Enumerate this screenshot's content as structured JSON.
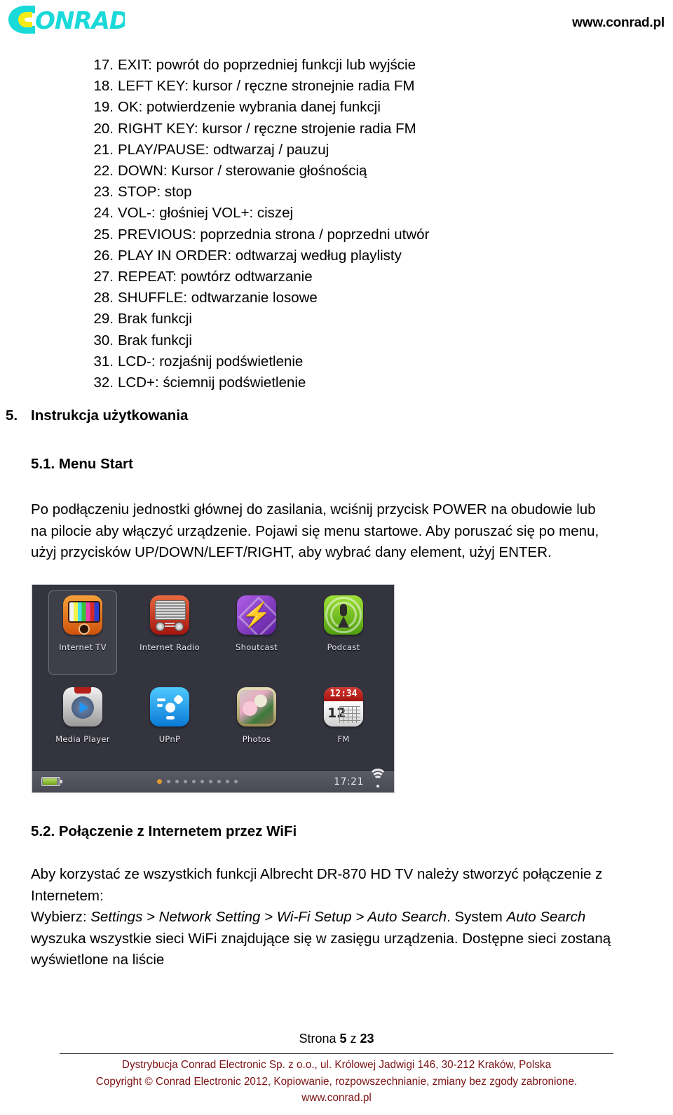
{
  "header": {
    "logo_text": "CONRAD",
    "url": "www.conrad.pl"
  },
  "remote_functions": [
    {
      "num": "17.",
      "text": "EXIT: powrót do poprzedniej funkcji lub wyjście"
    },
    {
      "num": "18.",
      "text": "LEFT KEY: kursor / ręczne stronejnie radia FM"
    },
    {
      "num": "19.",
      "text": "OK: potwierdzenie wybrania danej funkcji"
    },
    {
      "num": "20.",
      "text": "RIGHT KEY: kursor / ręczne strojenie radia FM"
    },
    {
      "num": "21.",
      "text": "PLAY/PAUSE: odtwarzaj / pauzuj"
    },
    {
      "num": "22.",
      "text": "DOWN: Kursor / sterowanie głośnością"
    },
    {
      "num": "23.",
      "text": "STOP: stop"
    },
    {
      "num": "24.",
      "text": "VOL-: głośniej VOL+: ciszej"
    },
    {
      "num": "25.",
      "text": "PREVIOUS: poprzednia strona / poprzedni utwór"
    },
    {
      "num": "26.",
      "text": "PLAY IN ORDER: odtwarzaj według playlisty"
    },
    {
      "num": "27.",
      "text": "REPEAT: powtórz odtwarzanie"
    },
    {
      "num": "28.",
      "text": "SHUFFLE: odtwarzanie losowe"
    },
    {
      "num": "29.",
      "text": "Brak funkcji"
    },
    {
      "num": "30.",
      "text": "Brak funkcji"
    },
    {
      "num": "31.",
      "text": "LCD-: rozjaśnij podświetlenie"
    },
    {
      "num": "32.",
      "text": "LCD+: ściemnij podświetlenie"
    }
  ],
  "sections": {
    "s5_num": "5.",
    "s5_title": "Instrukcja użytkowania",
    "s51_title": "5.1. Menu Start",
    "s51_p_line1": "Po podłączeniu jednostki głównej do zasilania, wciśnij przycisk POWER na obudowie lub",
    "s51_p_line2": "na pilocie aby włączyć urządzenie. Pojawi się menu startowe. Aby poruszać się po menu,",
    "s51_p_line3": "użyj przycisków UP/DOWN/LEFT/RIGHT, aby wybrać dany element, użyj ENTER.",
    "s52_title": "5.2. Połączenie z Internetem przez WiFi",
    "s52_line1": "Aby korzystać ze wszystkich funkcji Albrecht DR-870 HD TV należy stworzyć połączenie z",
    "s52_line2": "Internetem:",
    "s52_line3_pre": "Wybierz: ",
    "s52_line3_path": "Settings > Network Setting > Wi-Fi Setup > Auto Search",
    "s52_line3_mid": ". System ",
    "s52_line3_em2": "Auto Search",
    "s52_line4": "wyszuka wszystkie sieci WiFi znajdujące się w zasięgu urządzenia. Dostępne sieci zostaną",
    "s52_line5": "wyświetlone na liście"
  },
  "device_screenshot": {
    "selected_item": "Internet TV",
    "icons": [
      {
        "label": "Internet TV",
        "icon": "internet-tv-icon",
        "selected": true
      },
      {
        "label": "Internet Radio",
        "icon": "internet-radio-icon",
        "selected": false
      },
      {
        "label": "Shoutcast",
        "icon": "shoutcast-icon",
        "selected": false
      },
      {
        "label": "Podcast",
        "icon": "podcast-icon",
        "selected": false
      },
      {
        "label": "Media Player",
        "icon": "media-player-icon",
        "selected": false
      },
      {
        "label": "UPnP",
        "icon": "upnp-icon",
        "selected": false
      },
      {
        "label": "Photos",
        "icon": "photos-icon",
        "selected": false
      },
      {
        "label": "FM",
        "icon": "fm-icon",
        "selected": false
      }
    ],
    "status_bar": {
      "battery_icon": "battery-icon",
      "page_dots_total": 10,
      "page_dots_active_index": 0,
      "time": "17:21",
      "wifi_icon": "wifi-icon"
    },
    "fm_icon_time": "12:34",
    "fm_icon_day": "12"
  },
  "footer": {
    "page_prefix": "Strona ",
    "page_current": "5",
    "page_mid": " z ",
    "page_total": "23",
    "line1": "Dystrybucja Conrad Electronic Sp. z o.o., ul. Królowej Jadwigi 146, 30-212 Kraków, Polska",
    "line2": "Copyright © Conrad Electronic 2012, Kopiowanie, rozpowszechnianie, zmiany bez zgody zabronione.",
    "line3": "www.conrad.pl"
  },
  "colors": {
    "logo_cyan": "#1ad9d9",
    "logo_yellow": "#f3ec16",
    "footer_red": "#7b1113",
    "device_bg": "#34343f",
    "accent_dot": "#e09a30"
  }
}
